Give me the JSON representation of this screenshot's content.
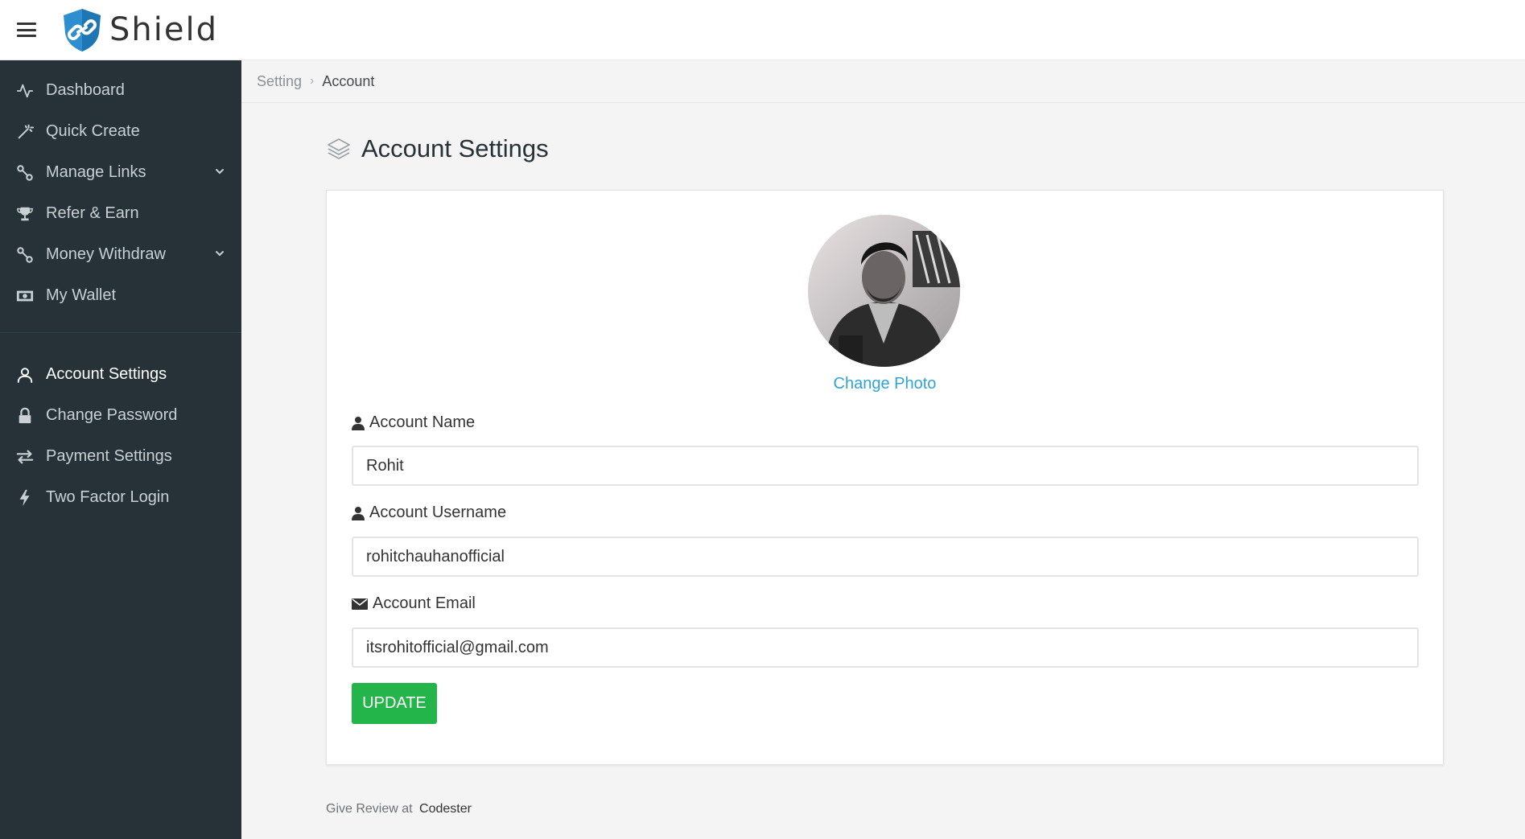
{
  "header": {
    "app_name": "Shield",
    "menu_icon": "hamburger-icon",
    "logo_icon": "shield-link-icon"
  },
  "sidebar": {
    "main_items": [
      {
        "label": "Dashboard",
        "icon": "activity-icon",
        "has_submenu": false
      },
      {
        "label": "Quick Create",
        "icon": "magic-wand-icon",
        "has_submenu": false
      },
      {
        "label": "Manage Links",
        "icon": "link-icon",
        "has_submenu": true
      },
      {
        "label": "Refer & Earn",
        "icon": "trophy-icon",
        "has_submenu": false
      },
      {
        "label": "Money Withdraw",
        "icon": "link-icon",
        "has_submenu": true
      },
      {
        "label": "My Wallet",
        "icon": "money-icon",
        "has_submenu": false
      }
    ],
    "settings_items": [
      {
        "label": "Account Settings",
        "icon": "user-icon",
        "active": true
      },
      {
        "label": "Change Password",
        "icon": "lock-icon",
        "active": false
      },
      {
        "label": "Payment Settings",
        "icon": "exchange-icon",
        "active": false
      },
      {
        "label": "Two Factor Login",
        "icon": "bolt-icon",
        "active": false
      }
    ]
  },
  "breadcrumb": {
    "parent": "Setting",
    "separator": "›",
    "current": "Account"
  },
  "page": {
    "title": "Account Settings",
    "title_icon": "layers-icon"
  },
  "profile": {
    "change_photo": "Change Photo",
    "fields": {
      "name": {
        "label": "Account Name",
        "value": "Rohit",
        "icon": "user-icon"
      },
      "username": {
        "label": "Account Username",
        "value": "rohitchauhanofficial",
        "icon": "user-icon"
      },
      "email": {
        "label": "Account Email",
        "value": "itsrohitofficial@gmail.com",
        "icon": "envelope-icon"
      }
    },
    "submit_label": "UPDATE"
  },
  "footer": {
    "text": "Give Review at",
    "link": "Codester"
  },
  "colors": {
    "sidebar_bg": "#263238",
    "accent_blue": "#2fa3d8",
    "button_green": "#23b54a"
  }
}
